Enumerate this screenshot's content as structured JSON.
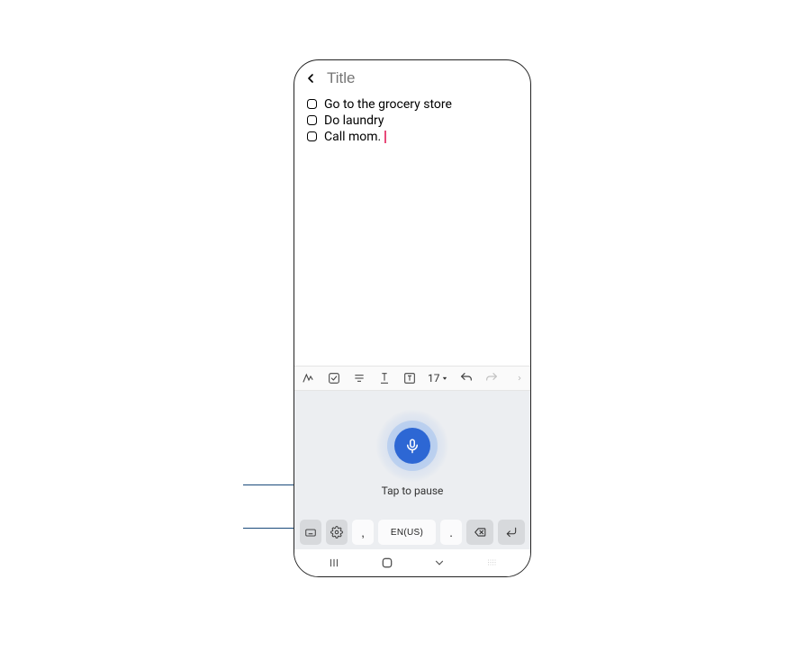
{
  "header": {
    "title_placeholder": "Title"
  },
  "todos": [
    {
      "text": "Go to the grocery store"
    },
    {
      "text": "Do laundry"
    },
    {
      "text": "Call mom."
    }
  ],
  "format_bar": {
    "font_size_label": "17",
    "icons": {
      "pen": "pen-icon",
      "check": "checkbox-icon",
      "text_style": "text-style-icon",
      "text_format": "text-format-icon",
      "text_box": "text-box-icon"
    }
  },
  "voice": {
    "label": "Tap to pause"
  },
  "keyboard": {
    "comma": ",",
    "period": ".",
    "language": "EN(US)"
  }
}
